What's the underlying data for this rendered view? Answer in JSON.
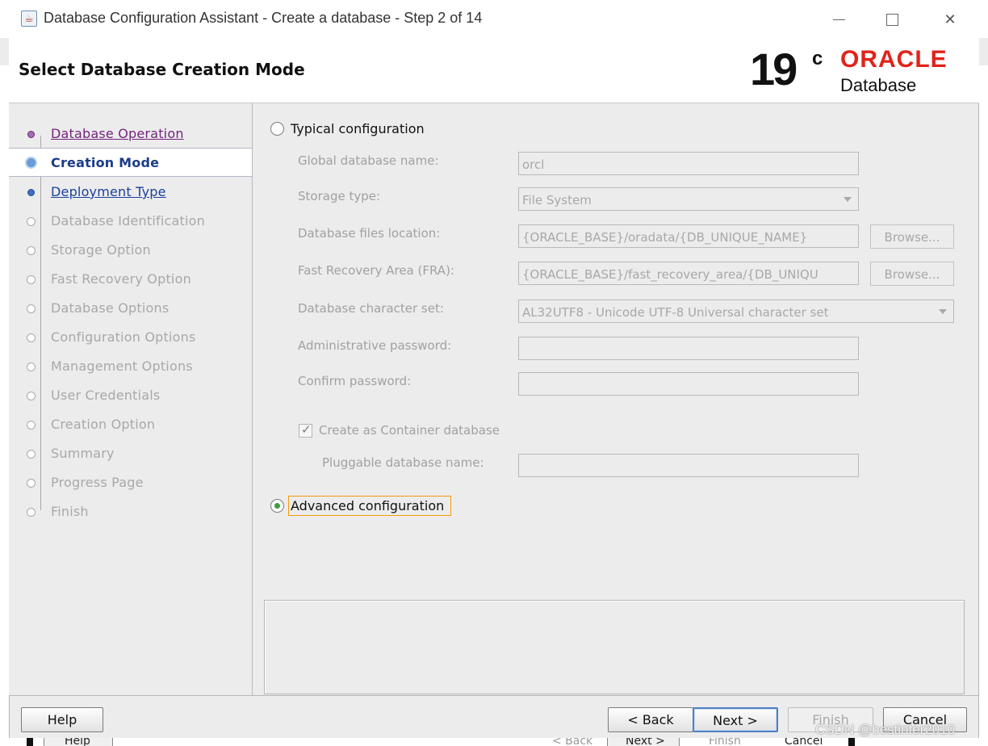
{
  "window": {
    "title": "Database Configuration Assistant - Create a database - Step 2 of 14",
    "minimize_icon": "minimize-icon",
    "maximize_icon": "maximize-icon",
    "close_icon": "close-icon",
    "close_glyph": "✕"
  },
  "header": {
    "page_title": "Select Database Creation Mode",
    "logo_version": "19",
    "logo_version_suffix": "c",
    "logo_brand": "ORACLE",
    "logo_product": "Database"
  },
  "sidebar": {
    "steps": [
      {
        "label": "Database Operation",
        "state": "visited"
      },
      {
        "label": "Creation Mode",
        "state": "current"
      },
      {
        "label": "Deployment Type",
        "state": "next"
      },
      {
        "label": "Database Identification",
        "state": "disabled"
      },
      {
        "label": "Storage Option",
        "state": "disabled"
      },
      {
        "label": "Fast Recovery Option",
        "state": "disabled"
      },
      {
        "label": "Database Options",
        "state": "disabled"
      },
      {
        "label": "Configuration Options",
        "state": "disabled"
      },
      {
        "label": "Management Options",
        "state": "disabled"
      },
      {
        "label": "User Credentials",
        "state": "disabled"
      },
      {
        "label": "Creation Option",
        "state": "disabled"
      },
      {
        "label": "Summary",
        "state": "disabled"
      },
      {
        "label": "Progress Page",
        "state": "disabled"
      },
      {
        "label": "Finish",
        "state": "disabled"
      }
    ]
  },
  "typical": {
    "label": "Typical configuration",
    "selected": false,
    "global_db_name_label": "Global database name:",
    "global_db_name_value": "orcl",
    "storage_type_label": "Storage type:",
    "storage_type_value": "File System",
    "db_files_location_label": "Database files location:",
    "db_files_location_value": "{ORACLE_BASE}/oradata/{DB_UNIQUE_NAME}",
    "fra_label": "Fast Recovery Area (FRA):",
    "fra_value": "{ORACLE_BASE}/fast_recovery_area/{DB_UNIQU",
    "browse_label": "Browse...",
    "charset_label": "Database character set:",
    "charset_value": "AL32UTF8 - Unicode UTF-8 Universal character set",
    "admin_password_label": "Administrative password:",
    "admin_password_value": "",
    "confirm_password_label": "Confirm password:",
    "confirm_password_value": "",
    "container_label": "Create as Container database",
    "container_checked": true,
    "pdb_name_label": "Pluggable database name:",
    "pdb_name_value": ""
  },
  "advanced": {
    "label": "Advanced configuration",
    "selected": true
  },
  "footer": {
    "help": "Help",
    "back": "< Back",
    "next": "Next >",
    "finish": "Finish",
    "cancel": "Cancel"
  },
  "behind_window": {
    "help": "Help",
    "back": "< Back",
    "next": "Next >",
    "finish": "Finish",
    "cancel": "Cancel"
  },
  "watermark": "CSDN @bestinter2010",
  "colors": {
    "oracle_red": "#e2231a",
    "focus_orange": "#f29b0f",
    "selected_radio": "#3aa13a",
    "current_step_text": "#1a3c8a",
    "visited_step_text": "#74237e"
  }
}
